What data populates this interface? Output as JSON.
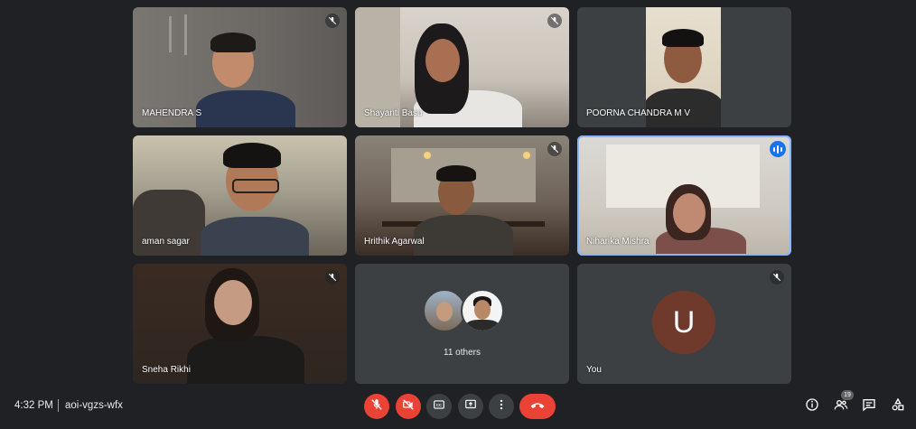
{
  "participants": [
    {
      "name": "MAHENDRA S",
      "muted": true
    },
    {
      "name": "Shayanti Basu",
      "muted": true
    },
    {
      "name": "POORNA CHANDRA M V",
      "muted": false
    },
    {
      "name": "aman sagar",
      "muted": false
    },
    {
      "name": "Hrithik Agarwal",
      "muted": true
    },
    {
      "name": "Niharika Mishra",
      "muted": false,
      "speaking": true
    },
    {
      "name": "Sneha Rikhi",
      "muted": true
    }
  ],
  "others": {
    "label": "11 others"
  },
  "self": {
    "name": "You",
    "initial": "U",
    "avatar_color": "#6f3a2c",
    "muted": true
  },
  "bottom_bar": {
    "time": "4:32 PM",
    "meeting_code": "aoi-vgzs-wfx",
    "controls": [
      "mic-off-icon",
      "camera-off-icon",
      "captions-icon",
      "present-icon",
      "more-options-icon",
      "hang-up-icon"
    ],
    "participant_count": "19",
    "right_icons": [
      "info-icon",
      "people-icon",
      "chat-icon",
      "activities-icon"
    ]
  },
  "colors": {
    "background": "#202124",
    "tile": "#3c4043",
    "danger": "#ea4335",
    "accent": "#1a73e8",
    "speaking_border": "#8ab4f8"
  }
}
